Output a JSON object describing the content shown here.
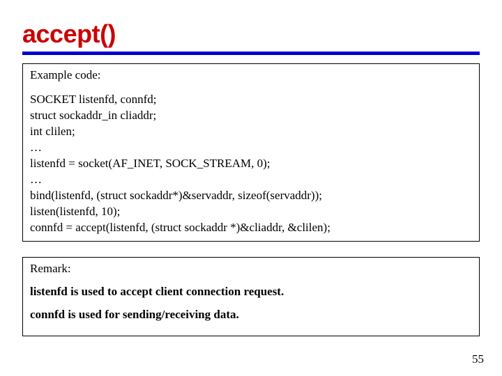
{
  "title": "accept()",
  "example": {
    "label": "Example code:",
    "lines": [
      "SOCKET listenfd, connfd;",
      "struct sockaddr_in cliaddr;",
      "int clilen;",
      "…",
      "listenfd = socket(AF_INET, SOCK_STREAM, 0);",
      "…",
      "bind(listenfd, (struct sockaddr*)&servaddr, sizeof(servaddr));",
      "listen(listenfd, 10);",
      "connfd = accept(listenfd, (struct sockaddr *)&cliaddr, &clilen);"
    ]
  },
  "remark": {
    "label": "Remark:",
    "line1_bold": "listenfd",
    "line1_rest": " is used to accept client connection request.",
    "line2_bold": "connfd",
    "line2_rest": " is used for sending/receiving data."
  },
  "pagenum": "55"
}
